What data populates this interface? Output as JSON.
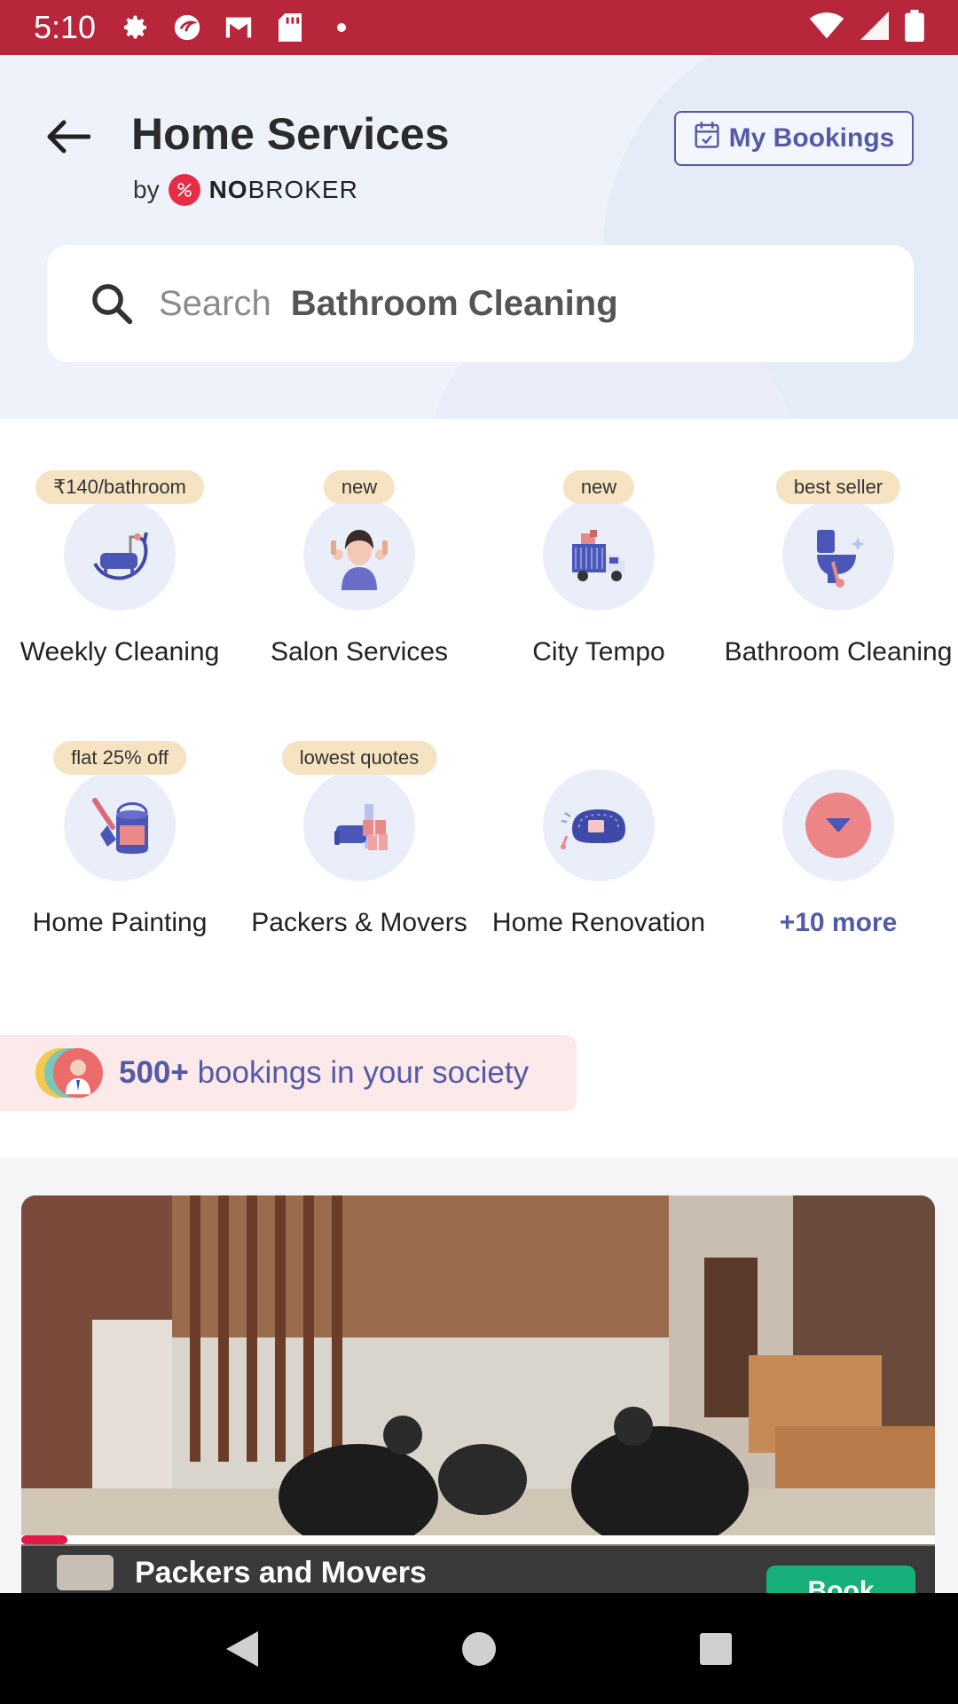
{
  "status_bar": {
    "time": "5:10",
    "icons": [
      "gear-icon",
      "app-icon",
      "gmail-icon",
      "sd-card-icon",
      "dot-icon"
    ],
    "right_icons": [
      "wifi-icon",
      "signal-icon",
      "battery-icon"
    ]
  },
  "header": {
    "title": "Home Services",
    "by_label": "by",
    "brand_prefix": "NO",
    "brand_suffix": "BROKER",
    "bookings_label": "My Bookings"
  },
  "search": {
    "placeholder": "Search",
    "value": "Bathroom Cleaning"
  },
  "services": [
    {
      "label": "Weekly Cleaning",
      "badge": "₹140/bathroom",
      "icon": "bathtub-icon"
    },
    {
      "label": "Salon Services",
      "badge": "new",
      "icon": "salon-icon"
    },
    {
      "label": "City Tempo",
      "badge": "new",
      "icon": "truck-icon"
    },
    {
      "label": "Bathroom Cleaning",
      "badge": "best seller",
      "icon": "toilet-icon"
    },
    {
      "label": "Home Painting",
      "badge": "flat 25% off",
      "icon": "paint-bucket-icon"
    },
    {
      "label": "Packers & Movers",
      "badge": "lowest quotes",
      "icon": "boxes-icon"
    },
    {
      "label": "Home Renovation",
      "badge": "",
      "icon": "sofa-icon"
    },
    {
      "label": "+10 more",
      "badge": "",
      "icon": "chevron-down-icon"
    }
  ],
  "society": {
    "count": "500+",
    "text": "bookings in your society"
  },
  "video": {
    "title": "Packers and Movers",
    "book_label": "Book",
    "progress": 0.05
  },
  "colors": {
    "status_bar": "#b7263b",
    "accent": "#545aa7",
    "badge": "#f6e3c2",
    "book": "#17b07a"
  }
}
